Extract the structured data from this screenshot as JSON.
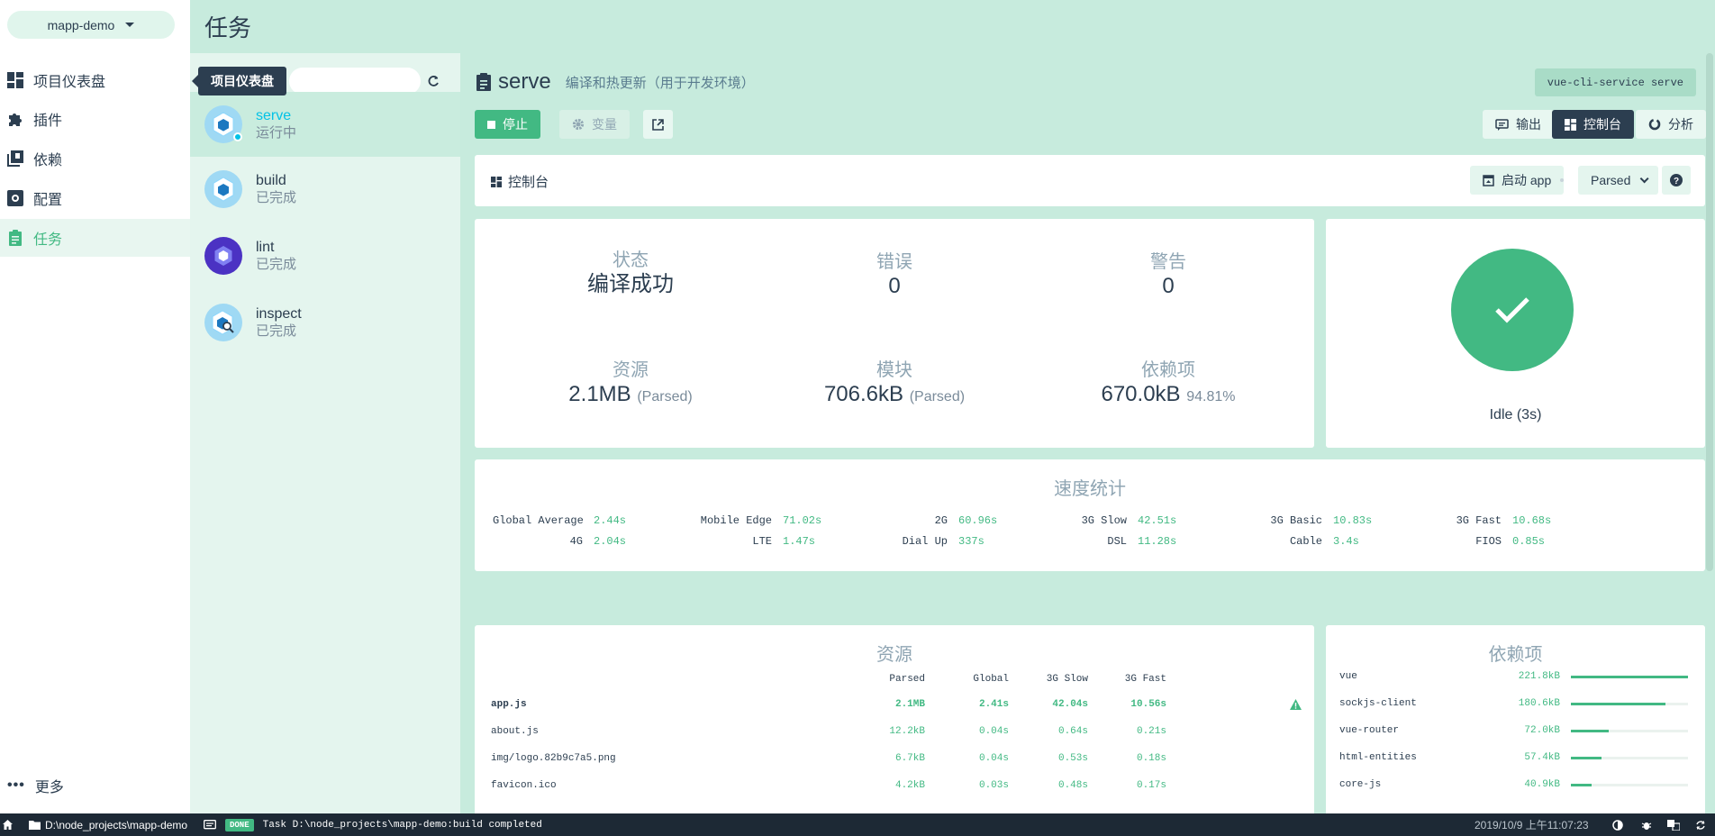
{
  "sidebar": {
    "project_name": "mapp-demo",
    "items": [
      {
        "label": "项目仪表盘"
      },
      {
        "label": "插件"
      },
      {
        "label": "依赖"
      },
      {
        "label": "配置"
      },
      {
        "label": "任务"
      }
    ],
    "more_label": "更多",
    "tooltip": "项目仪表盘"
  },
  "header": {
    "title": "任务"
  },
  "tasks": {
    "search_value": "",
    "items": [
      {
        "name": "serve",
        "status": "运行中"
      },
      {
        "name": "build",
        "status": "已完成"
      },
      {
        "name": "lint",
        "status": "已完成"
      },
      {
        "name": "inspect",
        "status": "已完成"
      }
    ]
  },
  "task": {
    "name": "serve",
    "description": "编译和热更新（用于开发环境）",
    "command": "vue-cli-service serve",
    "stop_label": "停止",
    "vars_label": "变量",
    "views": {
      "output": "输出",
      "dashboard": "控制台",
      "analyzer": "分析"
    }
  },
  "toolbar": {
    "title": "控制台",
    "launch_label": "启动 app",
    "mode_value": "Parsed"
  },
  "status": {
    "state_label": "状态",
    "state_value": "编译成功",
    "errors_label": "错误",
    "errors_value": "0",
    "warnings_label": "警告",
    "warnings_value": "0",
    "assets_label": "资源",
    "assets_value": "2.1MB",
    "assets_sub": "(Parsed)",
    "modules_label": "模块",
    "modules_value": "706.6kB",
    "modules_sub": "(Parsed)",
    "deps_label": "依赖项",
    "deps_value": "670.0kB",
    "deps_sub": "94.81%"
  },
  "idle": {
    "text": "Idle (3s)"
  },
  "speed": {
    "title": "速度统计",
    "rows": [
      [
        {
          "label": "Global Average",
          "value": "2.44s"
        },
        {
          "label": "Mobile Edge",
          "value": "71.02s"
        },
        {
          "label": "2G",
          "value": "60.96s"
        },
        {
          "label": "3G Slow",
          "value": "42.51s"
        },
        {
          "label": "3G Basic",
          "value": "10.83s"
        },
        {
          "label": "3G Fast",
          "value": "10.68s"
        }
      ],
      [
        {
          "label": "4G",
          "value": "2.04s"
        },
        {
          "label": "LTE",
          "value": "1.47s"
        },
        {
          "label": "Dial Up",
          "value": "337s"
        },
        {
          "label": "DSL",
          "value": "11.28s"
        },
        {
          "label": "Cable",
          "value": "3.4s"
        },
        {
          "label": "FIOS",
          "value": "0.85s"
        }
      ]
    ]
  },
  "assets": {
    "title": "资源",
    "columns": [
      "Parsed",
      "Global",
      "3G Slow",
      "3G Fast"
    ],
    "rows": [
      {
        "name": "app.js",
        "parsed": "2.1MB",
        "global": "2.41s",
        "slow": "42.04s",
        "fast": "10.56s"
      },
      {
        "name": "about.js",
        "parsed": "12.2kB",
        "global": "0.04s",
        "slow": "0.64s",
        "fast": "0.21s"
      },
      {
        "name": "img/logo.82b9c7a5.png",
        "parsed": "6.7kB",
        "global": "0.04s",
        "slow": "0.53s",
        "fast": "0.18s"
      },
      {
        "name": "favicon.ico",
        "parsed": "4.2kB",
        "global": "0.03s",
        "slow": "0.48s",
        "fast": "0.17s"
      }
    ]
  },
  "dependencies": {
    "title": "依赖项",
    "rows": [
      {
        "name": "vue",
        "size": "221.8kB",
        "ratio": 1.0
      },
      {
        "name": "sockjs-client",
        "size": "180.6kB",
        "ratio": 0.81
      },
      {
        "name": "vue-router",
        "size": "72.0kB",
        "ratio": 0.32
      },
      {
        "name": "html-entities",
        "size": "57.4kB",
        "ratio": 0.26
      },
      {
        "name": "core-js",
        "size": "40.9kB",
        "ratio": 0.18
      }
    ]
  },
  "statusbar": {
    "path": "D:\\node_projects\\mapp-demo",
    "badge": "DONE",
    "message": "Task D:\\node_projects\\mapp-demo:build completed",
    "datetime": "2019/10/9 上午11:07:23"
  },
  "colors": {
    "accent": "#42b983",
    "dark": "#2c3e50",
    "panel": "#c7ebdd",
    "running": "#03c2e6"
  }
}
